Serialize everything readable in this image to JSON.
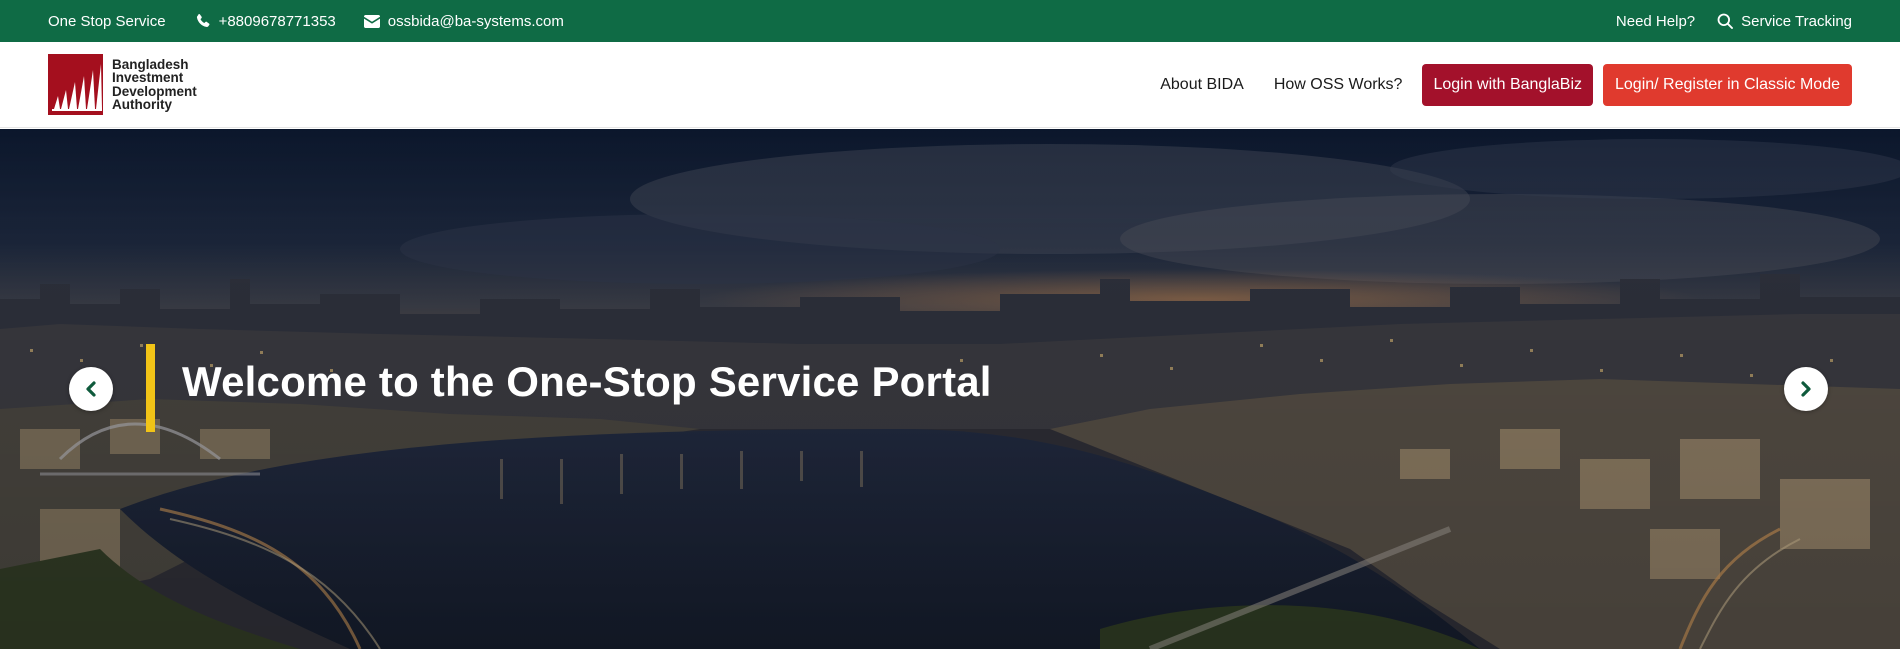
{
  "topbar": {
    "brand": "One Stop Service",
    "phone": "+8809678771353",
    "email": "ossbida@ba-systems.com",
    "help": "Need Help?",
    "tracking": "Service Tracking",
    "icons": {
      "phone": "phone-icon",
      "email": "envelope-icon",
      "tracking": "search-icon"
    },
    "background_color": "#0f6b45"
  },
  "header": {
    "logo": {
      "lines": [
        "Bangladesh",
        "Investment",
        "Development",
        "Authority"
      ],
      "mark_color": "#a40f1e"
    },
    "nav": [
      {
        "label": "About BIDA"
      },
      {
        "label": "How OSS Works?"
      }
    ],
    "buttons": {
      "banglabiz": "Login with BanglaBiz",
      "classic": "Login/ Register in Classic Mode"
    },
    "colors": {
      "banglabiz": "#a3112b",
      "classic": "#e03a2e"
    }
  },
  "hero": {
    "title": "Welcome to the One-Stop Service Portal",
    "accent_color": "#f2c417",
    "prev_icon": "chevron-left-icon",
    "next_icon": "chevron-right-icon"
  }
}
